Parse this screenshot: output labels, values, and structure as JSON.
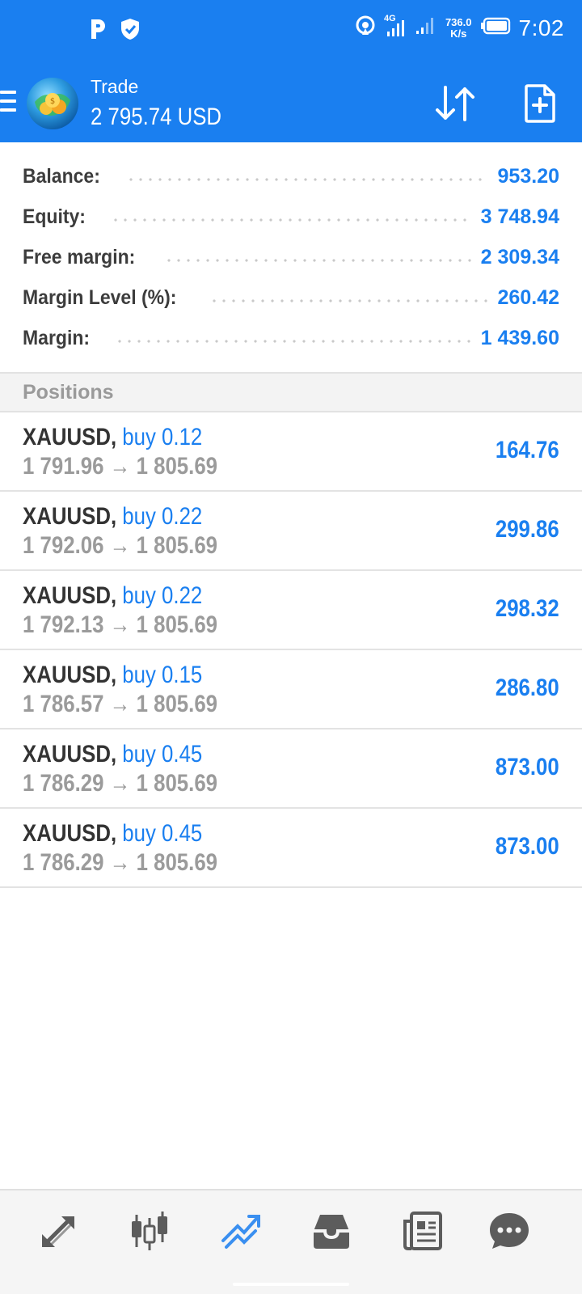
{
  "status_bar": {
    "time": "7:02",
    "network_type": "4G",
    "net_speed_value": "736.0",
    "net_speed_unit": "K/s",
    "icons": [
      "p-app-icon",
      "shield-check-icon",
      "hotspot-icon",
      "signal-icon",
      "signal-icon",
      "battery-icon"
    ]
  },
  "toolbar": {
    "title": "Trade",
    "balance": "2 795.74 USD"
  },
  "summary": [
    {
      "label": "Balance:",
      "value": "953.20"
    },
    {
      "label": "Equity:",
      "value": "3 748.94"
    },
    {
      "label": "Free margin:",
      "value": "2 309.34"
    },
    {
      "label": "Margin Level (%):",
      "value": "260.42"
    },
    {
      "label": "Margin:",
      "value": "1 439.60"
    }
  ],
  "positions_header": "Positions",
  "positions": [
    {
      "symbol": "XAUUSD,",
      "side": "buy 0.12",
      "open_price": "1 791.96",
      "arrow": "→",
      "current_price": "1 805.69",
      "profit": "164.76"
    },
    {
      "symbol": "XAUUSD,",
      "side": "buy 0.22",
      "open_price": "1 792.06",
      "arrow": "→",
      "current_price": "1 805.69",
      "profit": "299.86"
    },
    {
      "symbol": "XAUUSD,",
      "side": "buy 0.22",
      "open_price": "1 792.13",
      "arrow": "→",
      "current_price": "1 805.69",
      "profit": "298.32"
    },
    {
      "symbol": "XAUUSD,",
      "side": "buy 0.15",
      "open_price": "1 786.57",
      "arrow": "→",
      "current_price": "1 805.69",
      "profit": "286.80"
    },
    {
      "symbol": "XAUUSD,",
      "side": "buy 0.45",
      "open_price": "1 786.29",
      "arrow": "→",
      "current_price": "1 805.69",
      "profit": "873.00"
    },
    {
      "symbol": "XAUUSD,",
      "side": "buy 0.45",
      "open_price": "1 786.29",
      "arrow": "→",
      "current_price": "1 805.69",
      "profit": "873.00"
    }
  ],
  "bottom_nav": [
    {
      "icon": "quotes-arrows-icon",
      "active": false
    },
    {
      "icon": "candlestick-chart-icon",
      "active": false
    },
    {
      "icon": "trade-line-icon",
      "active": true
    },
    {
      "icon": "history-inbox-icon",
      "active": false
    },
    {
      "icon": "news-icon",
      "active": false
    },
    {
      "icon": "chat-icon",
      "active": false
    }
  ],
  "colors": {
    "accent": "#1a7ff0",
    "text_dark": "#333333",
    "text_muted": "#9b9b9b",
    "icon_inactive": "#5c5c5c"
  }
}
